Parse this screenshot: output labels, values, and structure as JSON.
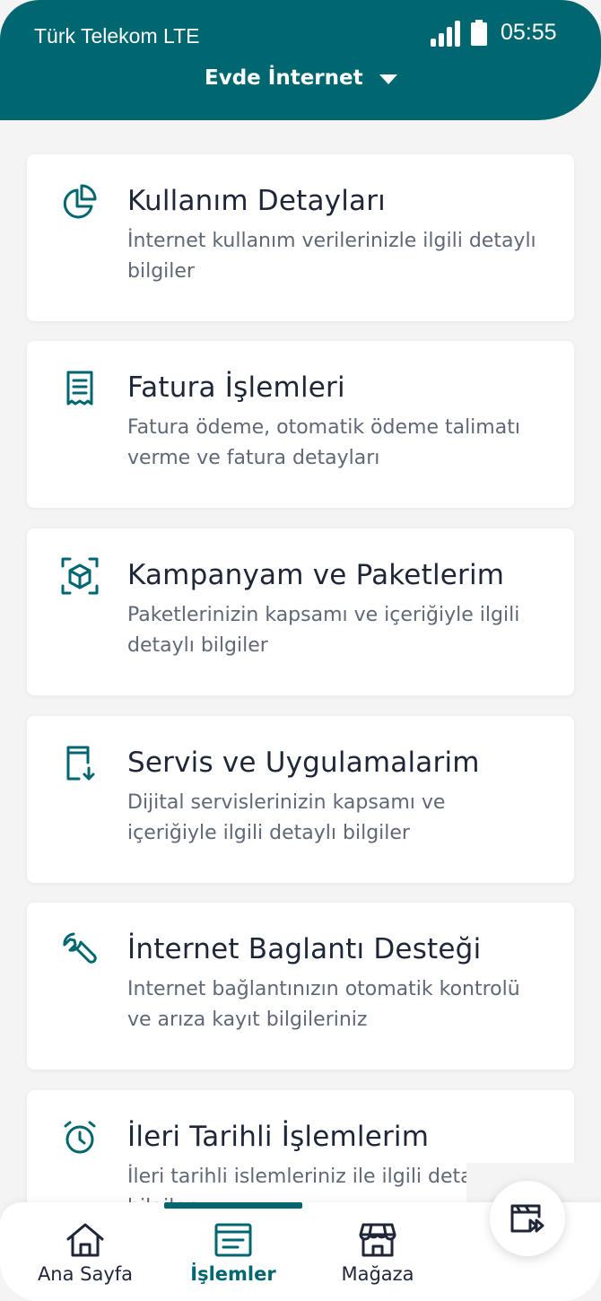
{
  "status_bar": {
    "carrier": "Türk Telekom LTE",
    "time": "05:55"
  },
  "header": {
    "title": "Evde İnternet"
  },
  "cards": [
    {
      "title": "Kullanım Detayları",
      "description": "İnternet kullanım verilerinizle ilgili detaylı bilgiler",
      "icon": "pie-chart-icon"
    },
    {
      "title": "Fatura İşlemleri",
      "description": "Fatura ödeme, otomatik ödeme talimatı verme ve fatura detayları",
      "icon": "receipt-icon"
    },
    {
      "title": "Kampanyam ve Paketlerim",
      "description": "Paketlerinizin kapsamı ve içeriğiyle ilgili detaylı bilgiler",
      "icon": "package-scan-icon"
    },
    {
      "title": "Servis ve Uygulamalarim",
      "description": "Dijital servislerinizin kapsamı ve içeriğiyle ilgili detaylı bilgiler",
      "icon": "download-device-icon"
    },
    {
      "title": "İnternet Baglantı Desteği",
      "description": "Internet bağlantınızın otomatik kontrolü ve arıza kayıt bilgileriniz",
      "icon": "wrench-icon"
    },
    {
      "title": "İleri Tarihli İşlemlerim",
      "description": "İleri tarihli islemleriniz ile ilgili detaylı bilgiler",
      "icon": "alarm-clock-icon"
    }
  ],
  "bottom_nav": {
    "items": [
      {
        "label": "Ana Sayfa",
        "icon": "home-icon",
        "active": false
      },
      {
        "label": "İşlemler",
        "icon": "transactions-icon",
        "active": true
      },
      {
        "label": "Mağaza",
        "icon": "store-icon",
        "active": false
      }
    ],
    "fab_icon": "media-play-icon"
  },
  "colors": {
    "primary": "#006771",
    "text_dark": "#1e2638",
    "text_muted": "#606876",
    "background": "#f4f4f5"
  }
}
